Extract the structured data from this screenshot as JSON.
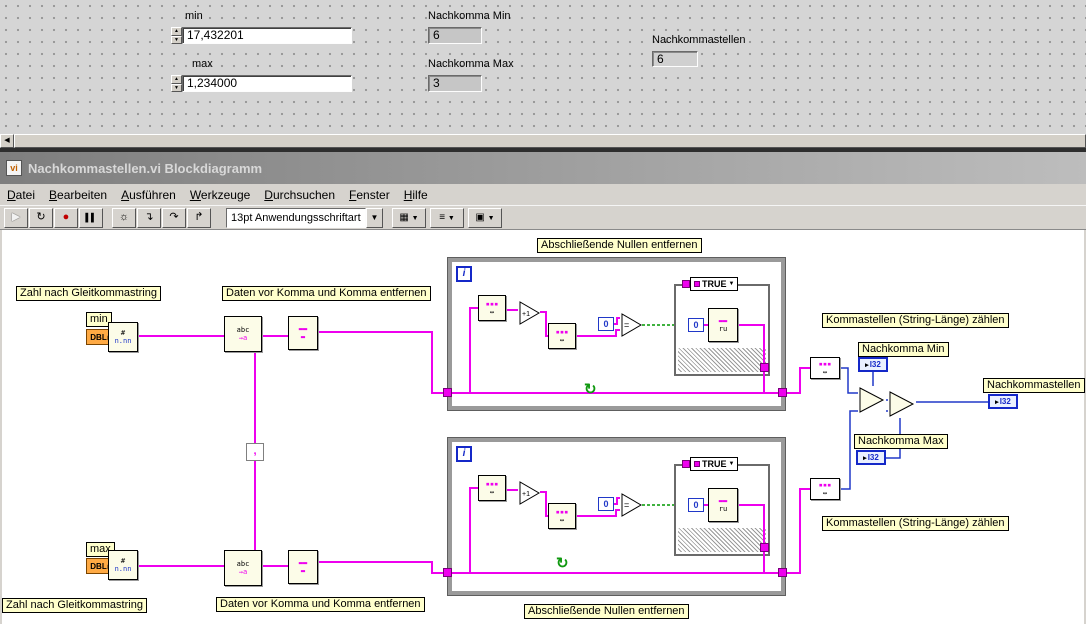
{
  "front_panel": {
    "min": {
      "label": "min",
      "value": "17,432201"
    },
    "max": {
      "label": "max",
      "value": "1,234000"
    },
    "nachkomma_min": {
      "label": "Nachkomma Min",
      "value": "6"
    },
    "nachkomma_max": {
      "label": "Nachkomma Max",
      "value": "3"
    },
    "nachkommastellen": {
      "label": "Nachkommastellen",
      "value": "6"
    }
  },
  "window": {
    "title": "Nachkommastellen.vi Blockdiagramm"
  },
  "menu": {
    "items": [
      "Datei",
      "Bearbeiten",
      "Ausführen",
      "Werkzeuge",
      "Durchsuchen",
      "Fenster",
      "Hilfe"
    ]
  },
  "toolbar": {
    "font_selector": "13pt Anwendungsschriftart"
  },
  "diagram": {
    "labels": {
      "zahl": "Zahl nach Gleitkommastring",
      "daten": "Daten vor Komma und Komma entfernen",
      "nullen": "Abschließende Nullen entfernen",
      "kommastellen": "Kommastellen (String-Länge) zählen",
      "nachkomma_min": "Nachkomma Min",
      "nachkomma_max": "Nachkomma Max",
      "nachkommastellen": "Nachkommastellen",
      "min": "min",
      "max": "max"
    },
    "terminals": {
      "dbl": "DBL",
      "i32": "I32"
    },
    "case_selector": "TRUE",
    "loop_counter": "i",
    "constants": {
      "zero": "0",
      "comma": ","
    }
  },
  "icons": {
    "scroll_left": "◀",
    "spinner_up": "▲",
    "spinner_down": "▼",
    "dropdown_arrow": "▼",
    "run": "▶",
    "run_continuous": "↻",
    "abort": "●",
    "pause": "▌▌",
    "highlight": "☼",
    "step_into": "↴",
    "step_over": "↷",
    "step_out": "↱",
    "align": "▦",
    "distribute": "≡",
    "reorder": "▣",
    "num_hash": "#",
    "num_fmt": "n.nn",
    "str_abc": "abc",
    "str_arrow": "→a",
    "bars2": "▬▬",
    "bars1": "▬",
    "dots": "▪▪▪",
    "len": "↔",
    "ru": "ru",
    "loop_arrow": "↻",
    "equals": "=",
    "plus_one": "+1",
    "term_arrow": "▸"
  },
  "colors": {
    "wire_string": "#ee00ee",
    "wire_int": "#2038c8",
    "wire_bool": "#009900",
    "dbl_fill": "#ffaa44",
    "label_bg": "#ffffcc"
  }
}
